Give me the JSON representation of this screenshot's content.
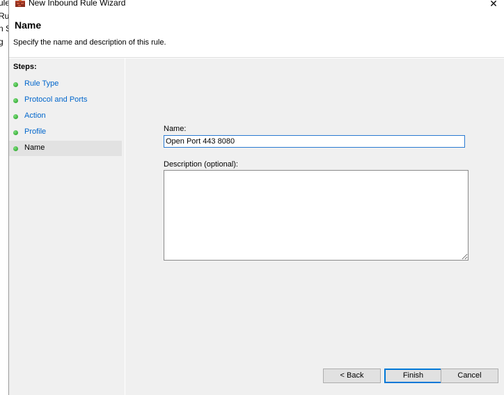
{
  "window": {
    "title": "New Inbound Rule Wizard",
    "close_glyph": "✕"
  },
  "background_fragments": [
    "ule",
    "Ru",
    "n S",
    "g"
  ],
  "header": {
    "title": "Name",
    "description": "Specify the name and description of this rule."
  },
  "steps": {
    "label": "Steps:",
    "items": [
      {
        "label": "Rule Type",
        "state": "completed"
      },
      {
        "label": "Protocol and Ports",
        "state": "completed"
      },
      {
        "label": "Action",
        "state": "completed"
      },
      {
        "label": "Profile",
        "state": "completed"
      },
      {
        "label": "Name",
        "state": "current"
      }
    ]
  },
  "form": {
    "name_label": "Name:",
    "name_value": "Open Port 443 8080",
    "description_label": "Description (optional):",
    "description_value": ""
  },
  "buttons": {
    "back": "< Back",
    "finish": "Finish",
    "cancel": "Cancel"
  },
  "colors": {
    "step_link": "#0066cc",
    "panel_bg": "#f0f0f0",
    "focus_border": "#0078d7"
  }
}
